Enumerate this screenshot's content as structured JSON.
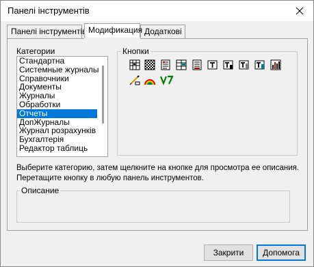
{
  "window": {
    "title": "Панелі інструментів"
  },
  "tabs": [
    {
      "label": "Панелі інструментів"
    },
    {
      "label": "Модификация"
    },
    {
      "label": "Додаткові"
    }
  ],
  "categories": {
    "label": "Категории",
    "items": [
      "Стандартна",
      "Системные журналы",
      "Справочники",
      "Документы",
      "Журналы",
      "Обработки",
      "Отчеты",
      "ДопЖурналы",
      "Журнал розрахунків",
      "Бухгалтерія",
      "Редактор таблиць"
    ],
    "selected": "Отчеты"
  },
  "buttons_group": {
    "label": "Кнопки",
    "icons": [
      "report-table-icon",
      "checkered-grid-icon",
      "report-list-icon",
      "report-columns-icon",
      "report-document-icon",
      "report-text-icon",
      "report-text-edit-icon",
      "report-text-select-icon",
      "report-chart-icon",
      "pencil-form-icon",
      "rainbow-icon",
      "v7-logo-icon"
    ]
  },
  "hint_text": "Выберите категорию, затем щелкните на кнопке для просмотра ее описания. Перетащите кнопку в любую панель инструментов.",
  "description_group": {
    "label": "Описание"
  },
  "footer": {
    "close_label": "Закрити",
    "help_label": "Допомога"
  }
}
